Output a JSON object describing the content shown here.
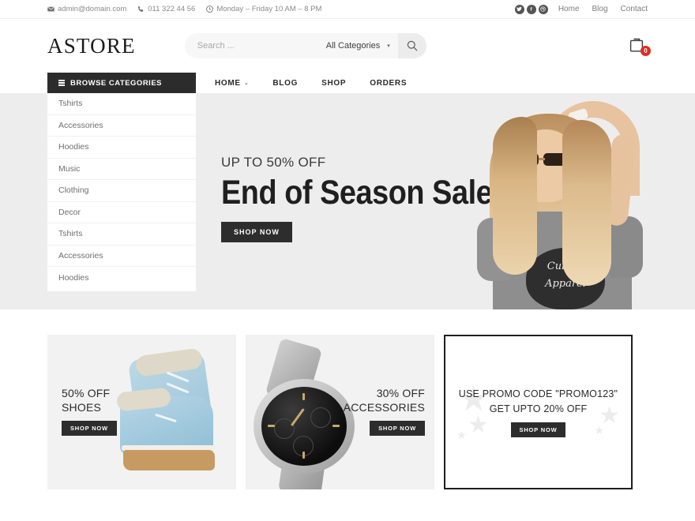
{
  "topbar": {
    "email": "admin@domain.com",
    "phone": "011 322 44 56",
    "hours": "Monday – Friday 10 AM – 8 PM",
    "email_icon": "envelope-icon",
    "phone_icon": "phone-icon",
    "clock_icon": "clock-icon",
    "socials": [
      {
        "name": "twitter-icon",
        "glyph": "t"
      },
      {
        "name": "facebook-icon",
        "glyph": "f"
      },
      {
        "name": "dribbble-icon",
        "glyph": "d"
      }
    ],
    "links": [
      {
        "label": "Home"
      },
      {
        "label": "Blog"
      },
      {
        "label": "Contact"
      }
    ]
  },
  "header": {
    "logo": "ASTORE",
    "search": {
      "placeholder": "Search ...",
      "value": "",
      "category": "All Categories",
      "caret": "▾",
      "search_icon": "search-icon"
    },
    "cart": {
      "icon": "shopping-bag-icon",
      "count": "0",
      "badge_color": "#e02b20"
    }
  },
  "nav": {
    "browse_label": "BROWSE CATEGORIES",
    "browse_icon": "list-icon",
    "items": [
      {
        "label": "HOME",
        "has_dropdown": true,
        "chevron": "⌄"
      },
      {
        "label": "BLOG",
        "has_dropdown": false
      },
      {
        "label": "SHOP",
        "has_dropdown": false
      },
      {
        "label": "ORDERS",
        "has_dropdown": false
      }
    ]
  },
  "categories": [
    {
      "label": "Tshirts"
    },
    {
      "label": "Accessories"
    },
    {
      "label": "Hoodies"
    },
    {
      "label": "Music"
    },
    {
      "label": "Clothing"
    },
    {
      "label": "Decor"
    },
    {
      "label": "Tshirts"
    },
    {
      "label": "Accessories"
    },
    {
      "label": "Hoodies"
    }
  ],
  "hero": {
    "kicker": "UP TO 50% OFF",
    "title": "End of Season Sale",
    "cta": "SHOP NOW",
    "image_alt": "woman-in-grey-tshirt",
    "shirt_print_line1": "Culprit",
    "shirt_print_line2": "Apparel",
    "background": "#ededed"
  },
  "promos": [
    {
      "line1": "50% OFF",
      "line2": "SHOES",
      "cta": "SHOP NOW",
      "image_alt": "light-blue-winter-boots"
    },
    {
      "line1": "30% OFF",
      "line2": "ACCESSORIES",
      "cta": "SHOP NOW",
      "image_alt": "silver-chronograph-watch"
    },
    {
      "line1": "USE PROMO CODE \"PROMO123\"",
      "line2": "GET UPTO 20% OFF",
      "cta": "SHOP NOW",
      "image_alt": "decorative-stars"
    }
  ]
}
